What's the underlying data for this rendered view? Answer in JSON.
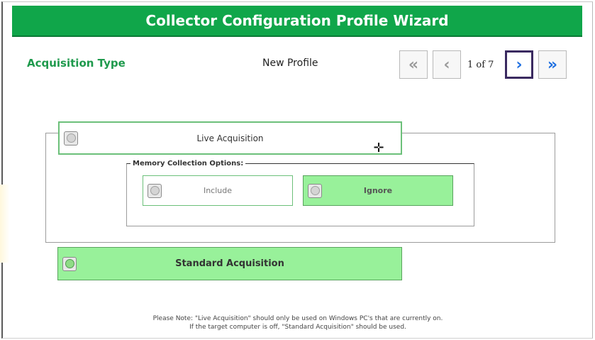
{
  "header": {
    "title": "Collector Configuration Profile Wizard"
  },
  "toolbar": {
    "step_title": "Acquisition Type",
    "profile_name": "New Profile",
    "first_glyph": "«",
    "prev_glyph": "‹",
    "page_indicator": "1 of 7",
    "next_glyph": "›",
    "last_glyph": "»"
  },
  "options": {
    "live_label": "Live Acquisition",
    "memory_legend": "Memory Collection Options:",
    "include_label": "Include",
    "ignore_label": "Ignore",
    "standard_label": "Standard Acquisition"
  },
  "note": {
    "line1": "Please Note: \"Live Acquisition\" should only be used on Windows PC's that are currently on.",
    "line2": "If the target computer is off, \"Standard Acquisition\" should be used."
  },
  "colors": {
    "banner": "#10a64a",
    "step_title": "#1f9a4d",
    "selected_option": "#98f19a",
    "nav_active_border": "#3a2a60",
    "nav_arrow_active": "#1e6fe0"
  },
  "state": {
    "selected_acquisition": "Standard Acquisition",
    "selected_memory_option": "Ignore"
  }
}
